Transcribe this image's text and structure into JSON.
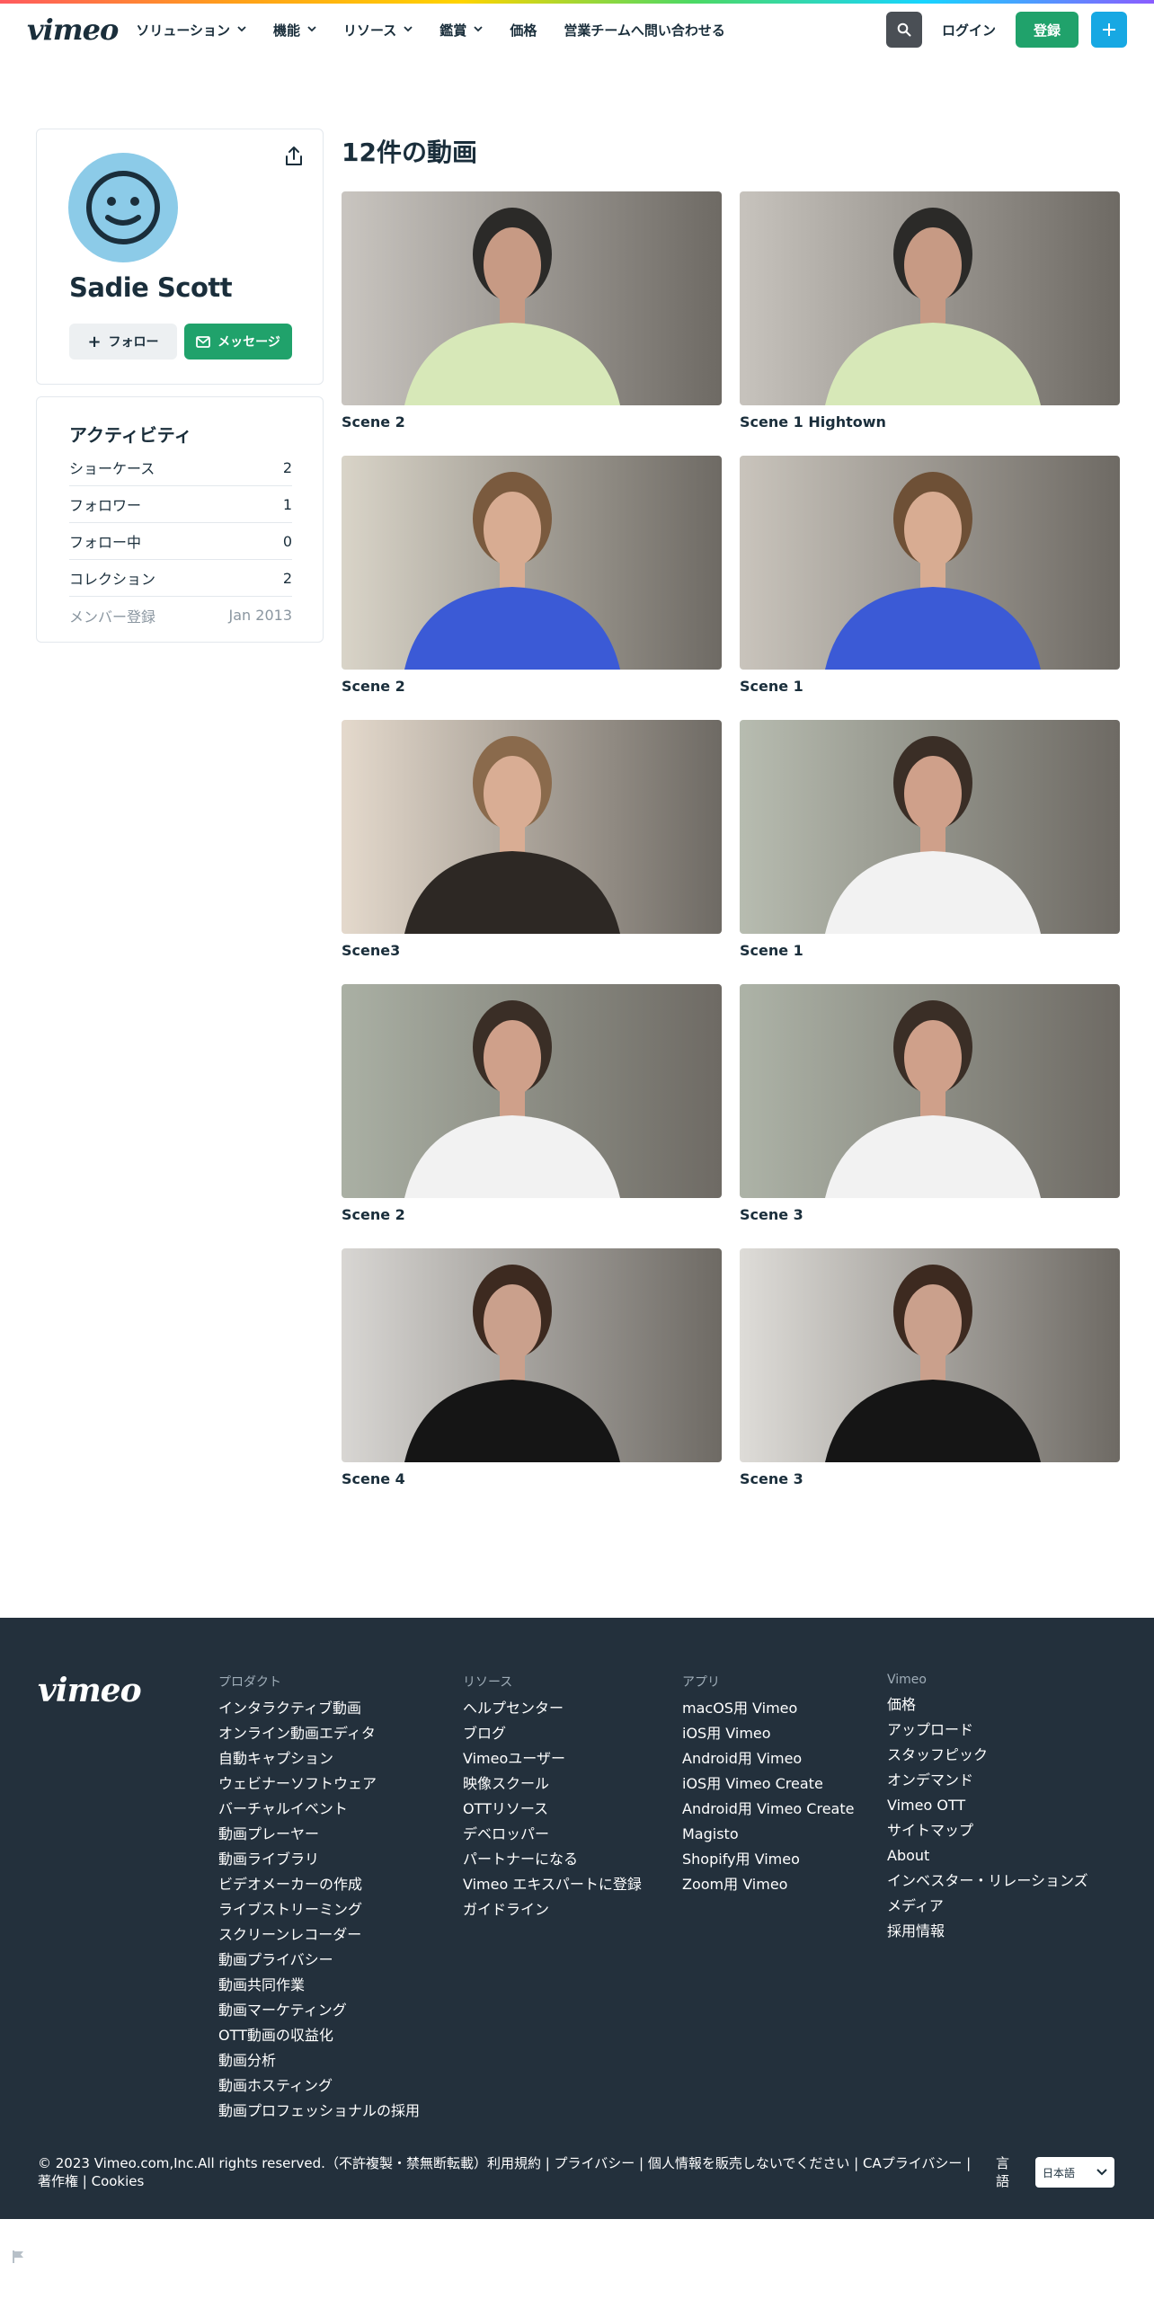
{
  "header": {
    "logo": "vimeo",
    "nav": [
      {
        "label": "ソリューション",
        "dropdown": true
      },
      {
        "label": "機能",
        "dropdown": true
      },
      {
        "label": "リソース",
        "dropdown": true
      },
      {
        "label": "鑑賞",
        "dropdown": true
      },
      {
        "label": "価格",
        "dropdown": false
      },
      {
        "label": "営業チームへ問い合わせる",
        "dropdown": false
      }
    ],
    "login_label": "ログイン",
    "signup_label": "登録",
    "search_icon": "search-icon",
    "plus_icon": "plus-icon"
  },
  "profile": {
    "name": "Sadie Scott",
    "follow_label": "フォロー",
    "message_label": "メッセージ",
    "avatar_color": "#8ccbe8"
  },
  "activity": {
    "title": "アクティビティ",
    "rows": [
      {
        "label": "ショーケース",
        "value": "2"
      },
      {
        "label": "フォロワー",
        "value": "1"
      },
      {
        "label": "フォロー中",
        "value": "0"
      },
      {
        "label": "コレクション",
        "value": "2"
      },
      {
        "label": "メンバー登録",
        "value": "Jan 2013"
      }
    ]
  },
  "videos": {
    "title": "12件の動画",
    "items": [
      {
        "title": "Scene 2",
        "palette": [
          "#c9c5c0",
          "#d7e8b8",
          "#2b2a28",
          "#c79a84"
        ]
      },
      {
        "title": "Scene 1 Hightown",
        "palette": [
          "#c7c3bd",
          "#d7e8b8",
          "#2b2a28",
          "#c79a84"
        ]
      },
      {
        "title": "Scene 2",
        "palette": [
          "#d9d4c8",
          "#3b5ad6",
          "#7a5a3e",
          "#d8ac92"
        ]
      },
      {
        "title": "Scene 1",
        "palette": [
          "#c9c4bc",
          "#3b5ad6",
          "#6e5036",
          "#d8ac92"
        ]
      },
      {
        "title": "Scene3",
        "palette": [
          "#e4d9cc",
          "#2d2824",
          "#8a6a4c",
          "#d9ad94"
        ]
      },
      {
        "title": "Scene 1",
        "palette": [
          "#b7bcb0",
          "#f2f2f2",
          "#3a2e26",
          "#cfa08a"
        ]
      },
      {
        "title": "Scene 2",
        "palette": [
          "#aab0a4",
          "#f2f2f2",
          "#3a2e26",
          "#cfa08a"
        ]
      },
      {
        "title": "Scene 3",
        "palette": [
          "#adb3a7",
          "#f2f2f2",
          "#3a2e26",
          "#cfa08a"
        ]
      },
      {
        "title": "Scene 4",
        "palette": [
          "#d8d6d3",
          "#151515",
          "#3d2a20",
          "#caa08c"
        ]
      },
      {
        "title": "Scene 3",
        "palette": [
          "#dedcd8",
          "#151515",
          "#3d2a20",
          "#caa08c"
        ]
      }
    ]
  },
  "footer": {
    "logo": "vimeo",
    "columns": [
      {
        "heading": "プロダクト",
        "links": [
          "インタラクティブ動画",
          "オンライン動画エディタ",
          "自動キャプション",
          "ウェビナーソフトウェア",
          "バーチャルイベント",
          "動画プレーヤー",
          "動画ライブラリ",
          "ビデオメーカーの作成",
          "ライブストリーミング",
          "スクリーンレコーダー",
          "動画プライバシー",
          "動画共同作業",
          "動画マーケティング",
          "OTT動画の収益化",
          "動画分析",
          "動画ホスティング",
          "動画プロフェッショナルの採用"
        ]
      },
      {
        "heading": "リソース",
        "links": [
          "ヘルプセンター",
          "ブログ",
          "Vimeoユーザー",
          "映像スクール",
          "OTTリソース",
          "デベロッパー",
          "パートナーになる",
          "Vimeo エキスパートに登録",
          "ガイドライン"
        ]
      },
      {
        "heading": "アプリ",
        "links": [
          "macOS用 Vimeo",
          "iOS用 Vimeo",
          "Android用 Vimeo",
          "iOS用 Vimeo Create",
          "Android用 Vimeo Create",
          "Magisto",
          "Shopify用 Vimeo",
          "Zoom用 Vimeo"
        ]
      },
      {
        "heading": "Vimeo",
        "links": [
          "価格",
          "アップロード",
          "スタッフピック",
          "オンデマンド",
          "Vimeo OTT",
          "サイトマップ",
          "About",
          "インベスター・リレーションズ",
          "メディア",
          "採用情報"
        ]
      }
    ],
    "legal": "© 2023 Vimeo.com,Inc.All rights reserved.（不許複製・禁無断転載）利用規約 | プライバシー | 個人情報を販売しないでください | CAプライバシー | 著作権 | Cookies",
    "lang_label": "言語",
    "lang_value": "日本語"
  },
  "colors": {
    "accent_green": "#20a26b",
    "accent_blue": "#17a8e3",
    "footer_bg": "#23303c",
    "text_dark": "#1a2e3b"
  }
}
